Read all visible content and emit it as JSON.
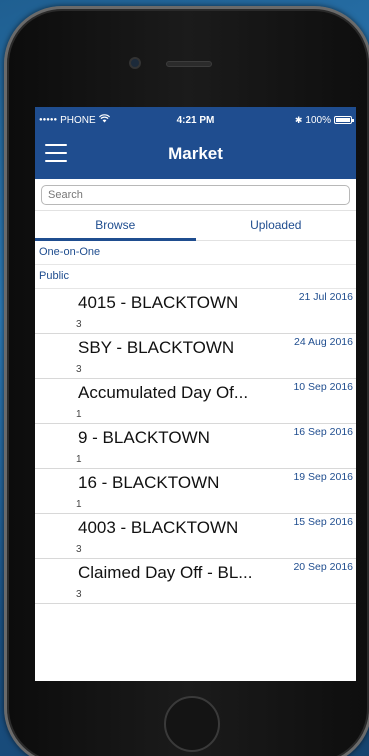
{
  "status_bar": {
    "signal": "●●●●●",
    "carrier": "PHONE",
    "wifi_icon": "wifi-icon",
    "time": "4:21 PM",
    "bluetooth": "✱",
    "battery_percent": "100%"
  },
  "nav": {
    "title": "Market",
    "menu_icon": "hamburger-menu-icon"
  },
  "search": {
    "placeholder": "Search",
    "value": ""
  },
  "tabs": [
    {
      "label": "Browse",
      "active": true
    },
    {
      "label": "Uploaded",
      "active": false
    }
  ],
  "sections": {
    "one_on_one": "One-on-One",
    "public": "Public"
  },
  "items": [
    {
      "title": "4015 - BLACKTOWN",
      "date": "21 Jul 2016",
      "count": "3"
    },
    {
      "title": "SBY - BLACKTOWN",
      "date": "24 Aug 2016",
      "count": "3"
    },
    {
      "title": "Accumulated Day Of...",
      "date": "10 Sep 2016",
      "count": "1"
    },
    {
      "title": "9 - BLACKTOWN",
      "date": "16 Sep 2016",
      "count": "1"
    },
    {
      "title": "16 - BLACKTOWN",
      "date": "19 Sep 2016",
      "count": "1"
    },
    {
      "title": "4003 - BLACKTOWN",
      "date": "15 Sep 2016",
      "count": "3"
    },
    {
      "title": "Claimed Day Off - BL...",
      "date": "20 Sep 2016",
      "count": "3"
    }
  ],
  "colors": {
    "header": "#1f4d8f",
    "accent": "#1f4d8f",
    "background": "#ffffff"
  }
}
